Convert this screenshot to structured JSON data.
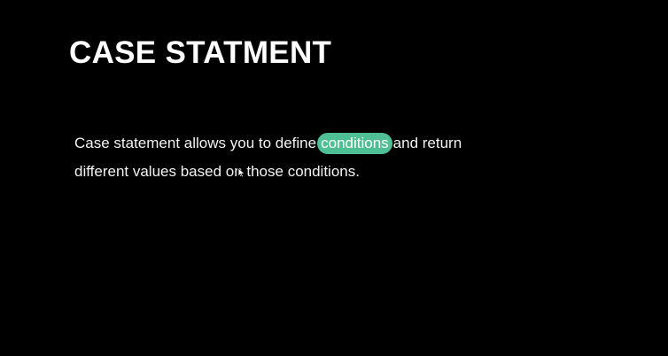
{
  "slide": {
    "title": "CASE STATMENT",
    "body": {
      "line1_before": "Case statement allows you to define",
      "highlight": "conditions",
      "line1_after": "and return",
      "line2": "different values based on those conditions."
    },
    "colors": {
      "background": "#000000",
      "text": "#ffffff",
      "highlight": "#4fbf95"
    },
    "icons": {
      "cursor": "mouse-pointer-icon"
    }
  }
}
